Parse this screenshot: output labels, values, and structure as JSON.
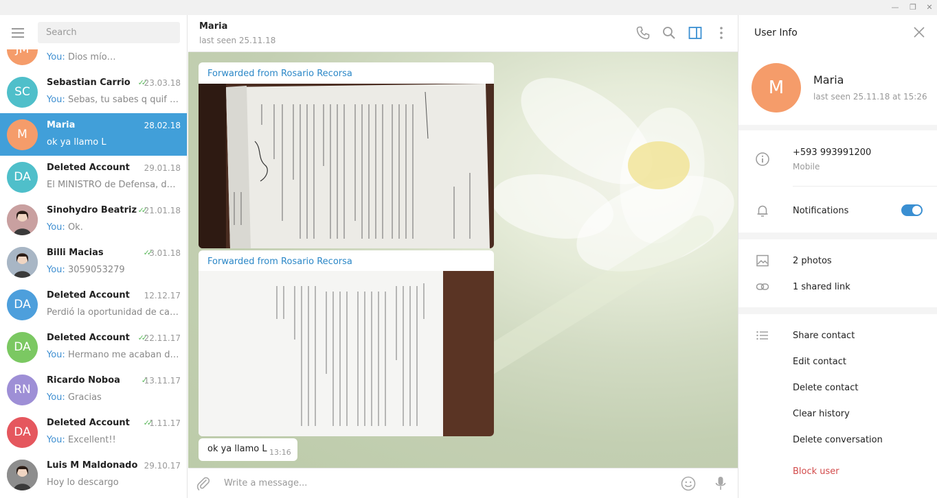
{
  "search": {
    "placeholder": "Search"
  },
  "chats": [
    {
      "initials": "JM",
      "color": "#f59c6a",
      "name": "",
      "date": "",
      "you": "You:",
      "preview": "Dios mío…",
      "photo": false,
      "checks": ""
    },
    {
      "initials": "SC",
      "color": "#4fbfca",
      "name": "Sebastian Carrio",
      "date": "23.03.18",
      "you": "You:",
      "preview": "Sebas, tu sabes q quif te q...",
      "photo": false,
      "checks": "double"
    },
    {
      "initials": "M",
      "color": "#f59c6a",
      "name": "Maria",
      "date": "28.02.18",
      "you": "",
      "preview": "ok ya llamo L",
      "photo": false,
      "checks": "",
      "active": true
    },
    {
      "initials": "DA",
      "color": "#4fbfca",
      "name": "Deleted Account",
      "date": "29.01.18",
      "you": "",
      "preview": "El MINISTRO de Defensa, defini...",
      "photo": false,
      "checks": ""
    },
    {
      "initials": "",
      "color": "#c9a0a0",
      "name": "Sinohydro Beatriz",
      "date": "21.01.18",
      "you": "You:",
      "preview": "Ok.",
      "photo": true,
      "checks": "double"
    },
    {
      "initials": "",
      "color": "#a8b6c5",
      "name": "Billi Macias",
      "date": "3.01.18",
      "you": "You:",
      "preview": "3059053279",
      "photo": true,
      "checks": "double"
    },
    {
      "initials": "DA",
      "color": "#4d9fdc",
      "name": "Deleted Account",
      "date": "12.12.17",
      "you": "",
      "preview": "Perdió la oportunidad de callar",
      "photo": false,
      "checks": ""
    },
    {
      "initials": "DA",
      "color": "#7bc862",
      "name": "Deleted Account",
      "date": "22.11.17",
      "you": "You:",
      "preview": "Hermano me acaban de ll...",
      "photo": false,
      "checks": "double"
    },
    {
      "initials": "RN",
      "color": "#9e8fd6",
      "name": "Ricardo Noboa",
      "date": "13.11.17",
      "you": "You:",
      "preview": "Gracias",
      "photo": false,
      "checks": "single"
    },
    {
      "initials": "DA",
      "color": "#e5575e",
      "name": "Deleted Account",
      "date": "1.11.17",
      "you": "You:",
      "preview": "Excellent!!",
      "photo": false,
      "checks": "double"
    },
    {
      "initials": "",
      "color": "#8d8d8d",
      "name": "Luis M Maldonado",
      "date": "29.10.17",
      "you": "",
      "preview": "Hoy lo descargo",
      "photo": true,
      "checks": ""
    }
  ],
  "header": {
    "name": "Maria",
    "status": "last seen 25.11.18"
  },
  "messages": {
    "forwards": [
      {
        "label": "Forwarded from Rosario Recorsa"
      },
      {
        "label": "Forwarded from Rosario Recorsa"
      }
    ],
    "text": "ok ya llamo L",
    "time": "13:16"
  },
  "composer": {
    "placeholder": "Write a message..."
  },
  "info": {
    "title": "User Info",
    "initial": "M",
    "name": "Maria",
    "seen": "last seen 25.11.18 at 15:26",
    "phone": "+593 993991200",
    "phone_label": "Mobile",
    "notifications": "Notifications",
    "notifications_on": true,
    "photos": "2 photos",
    "links": "1 shared link",
    "share": "Share contact",
    "edit": "Edit contact",
    "delete": "Delete contact",
    "clear": "Clear history",
    "delete_conv": "Delete conversation",
    "block": "Block user"
  },
  "icons": {
    "menu": "hamburger-icon",
    "phone": "phone-icon",
    "search": "search-icon",
    "sidebar": "sidebar-toggle-icon",
    "more": "more-vertical-icon",
    "attach": "paperclip-icon",
    "emoji": "emoji-icon",
    "mic": "microphone-icon",
    "close": "close-icon",
    "info": "info-icon",
    "bell": "bell-icon",
    "photo": "photo-icon",
    "link": "link-icon",
    "list": "list-icon"
  },
  "colors": {
    "accent": "#419fd9",
    "link": "#2b87c7",
    "danger": "#d24a4a"
  }
}
